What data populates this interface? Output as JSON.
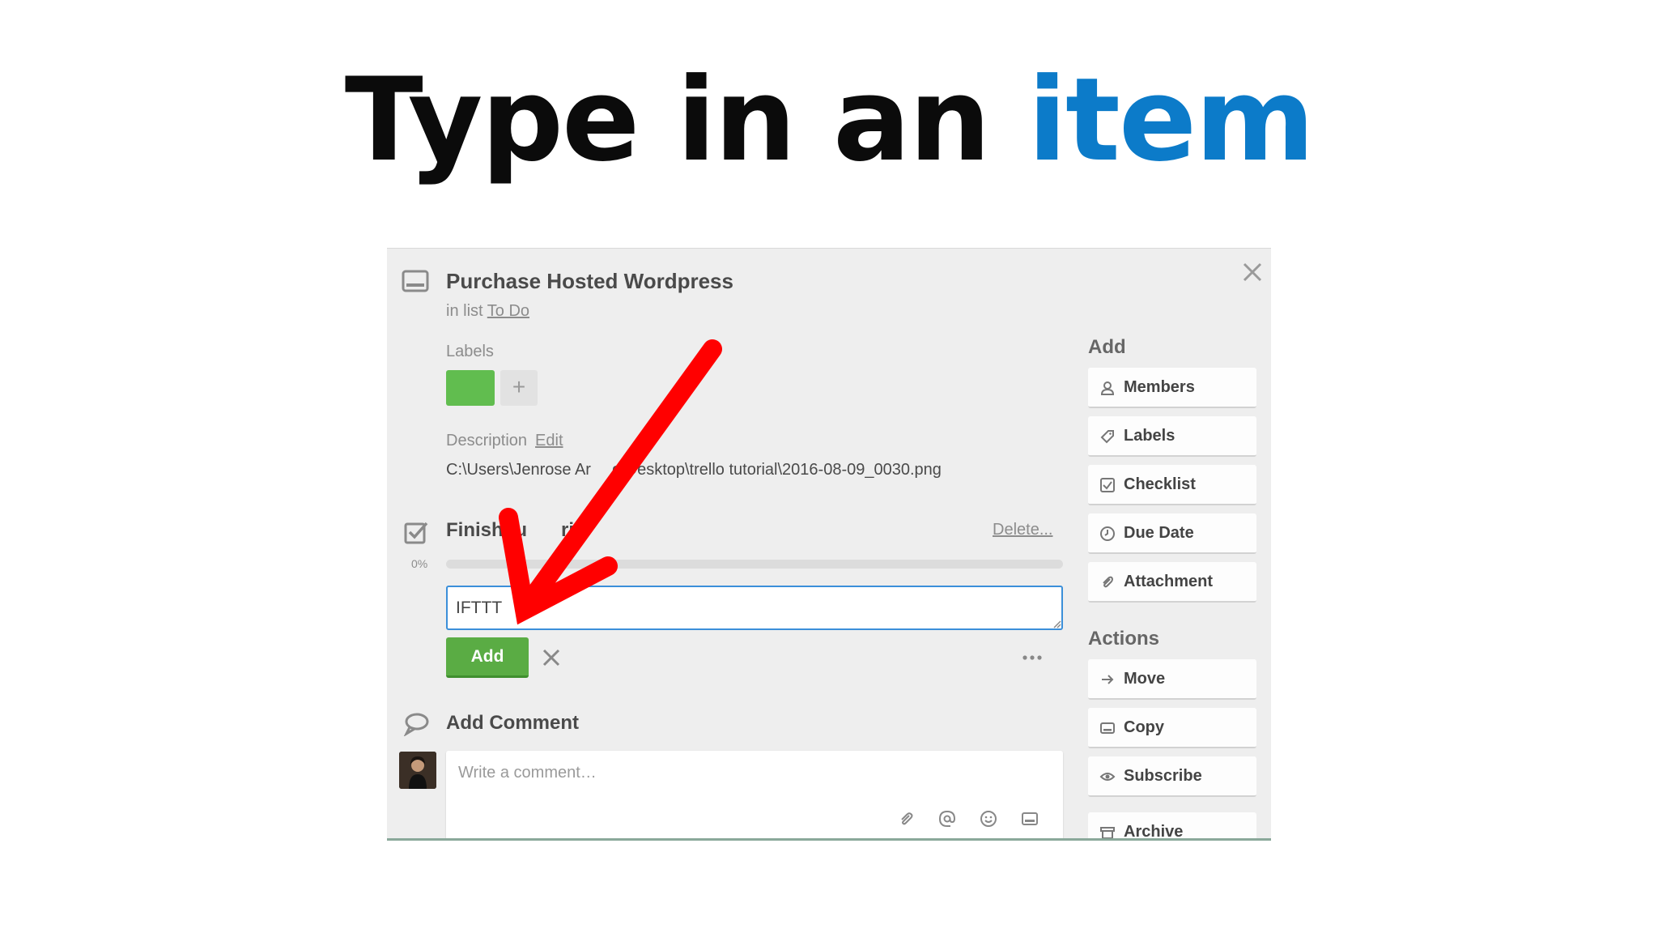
{
  "headline": {
    "text_before": "Type in an ",
    "text_accent": "item"
  },
  "card": {
    "title": "Purchase Hosted Wordpress",
    "in_list_prefix": "in list ",
    "list_name": "To Do",
    "labels_heading": "Labels",
    "label_add_symbol": "+",
    "description_heading": "Description",
    "description_edit": "Edit",
    "description_text": "C:\\Users\\Jenrose Ar",
    "description_text_end": "o\\Desktop\\trello tutorial\\2016-08-09_0030.png",
    "checklist_title": "Finish tu",
    "checklist_title_end": "ri",
    "checklist_delete": "Delete...",
    "checklist_percent": "0%",
    "checklist_progress": 0,
    "item_input_value": "IFTTT",
    "add_button": "Add",
    "comment_heading": "Add Comment",
    "comment_placeholder": "Write a comment…"
  },
  "sidebar": {
    "add_heading": "Add",
    "add_buttons": [
      {
        "label": "Members",
        "icon": "person-icon"
      },
      {
        "label": "Labels",
        "icon": "tag-icon"
      },
      {
        "label": "Checklist",
        "icon": "checkbox-icon"
      },
      {
        "label": "Due Date",
        "icon": "clock-icon"
      },
      {
        "label": "Attachment",
        "icon": "paperclip-icon"
      }
    ],
    "actions_heading": "Actions",
    "action_buttons": [
      {
        "label": "Move",
        "icon": "arrow-right-icon"
      },
      {
        "label": "Copy",
        "icon": "card-icon"
      },
      {
        "label": "Subscribe",
        "icon": "eye-icon"
      },
      {
        "label": "Archive",
        "icon": "archive-icon"
      }
    ]
  },
  "colors": {
    "accent": "#0c7bc9",
    "label_green": "#61bd4f",
    "add_button": "#5aac44",
    "arrow": "#ff0000"
  }
}
